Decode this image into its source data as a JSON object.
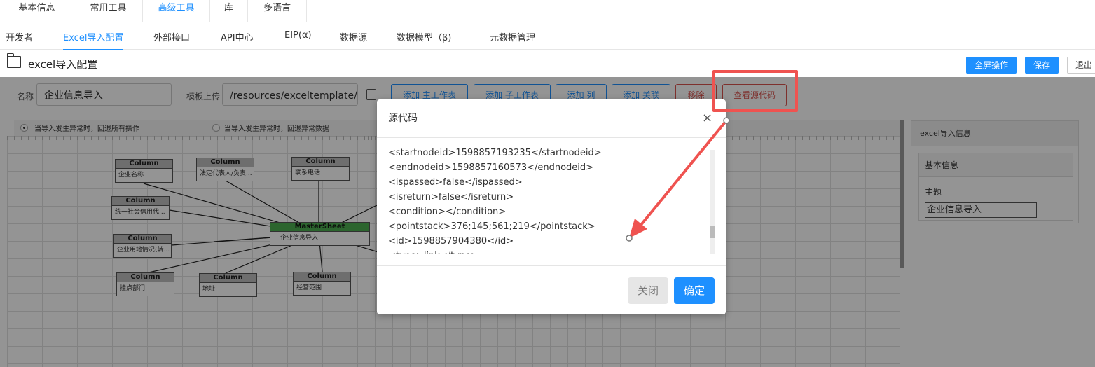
{
  "top_tabs": [
    "基本信息",
    "常用工具",
    "高级工具",
    "库",
    "多语言"
  ],
  "sub_tabs": [
    "开发者",
    "Excel导入配置",
    "外部接口",
    "API中心",
    "EIP(α)",
    "数据源",
    "数据模型（β)",
    "元数据管理"
  ],
  "page": {
    "title": "excel导入配置",
    "fullscreen_btn": "全屏操作",
    "save_btn": "保存",
    "exit_btn": "退出"
  },
  "form": {
    "name_label": "名称",
    "name_value": "企业信息导入",
    "template_label": "模板上传",
    "template_value": "/resources/exceltemplate/企业",
    "toolbar": [
      "添加 主工作表",
      "添加 子工作表",
      "添加 列",
      "添加 关联",
      "移除",
      "查看源代码"
    ],
    "radio1": "当导入发生异常时，回退所有操作",
    "radio2": "当导入发生异常时，回退异常数据"
  },
  "diagram": {
    "column_header": "Column",
    "master_header": "MasterSheet",
    "master_body": "企业信息导入",
    "columns": [
      "企业名称",
      "法定代表人/负责...",
      "联系电话",
      "统一社会信用代...",
      "企业用地情况(转...",
      "挂点部门",
      "地址",
      "经营范围"
    ]
  },
  "right_panel": {
    "header": "excel导入信息",
    "section": "基本信息",
    "subject_label": "主题",
    "subject_value": "企业信息导入"
  },
  "modal": {
    "title": "源代码",
    "close_icon": "×",
    "lines": [
      "<startnodeid>1598857193235</startnodeid>",
      "<endnodeid>1598857160573</endnodeid>",
      "<ispassed>false</ispassed>",
      "<isreturn>false</isreturn>",
      "<condition></condition>",
      "<pointstack>376;145;561;219</pointstack>",
      "<id>1598857904380</id>",
      "<type>link</type>"
    ],
    "close_btn": "关闭",
    "ok_btn": "确定"
  },
  "colors": {
    "accent": "#1e90ff",
    "annotation": "#ef5350"
  }
}
